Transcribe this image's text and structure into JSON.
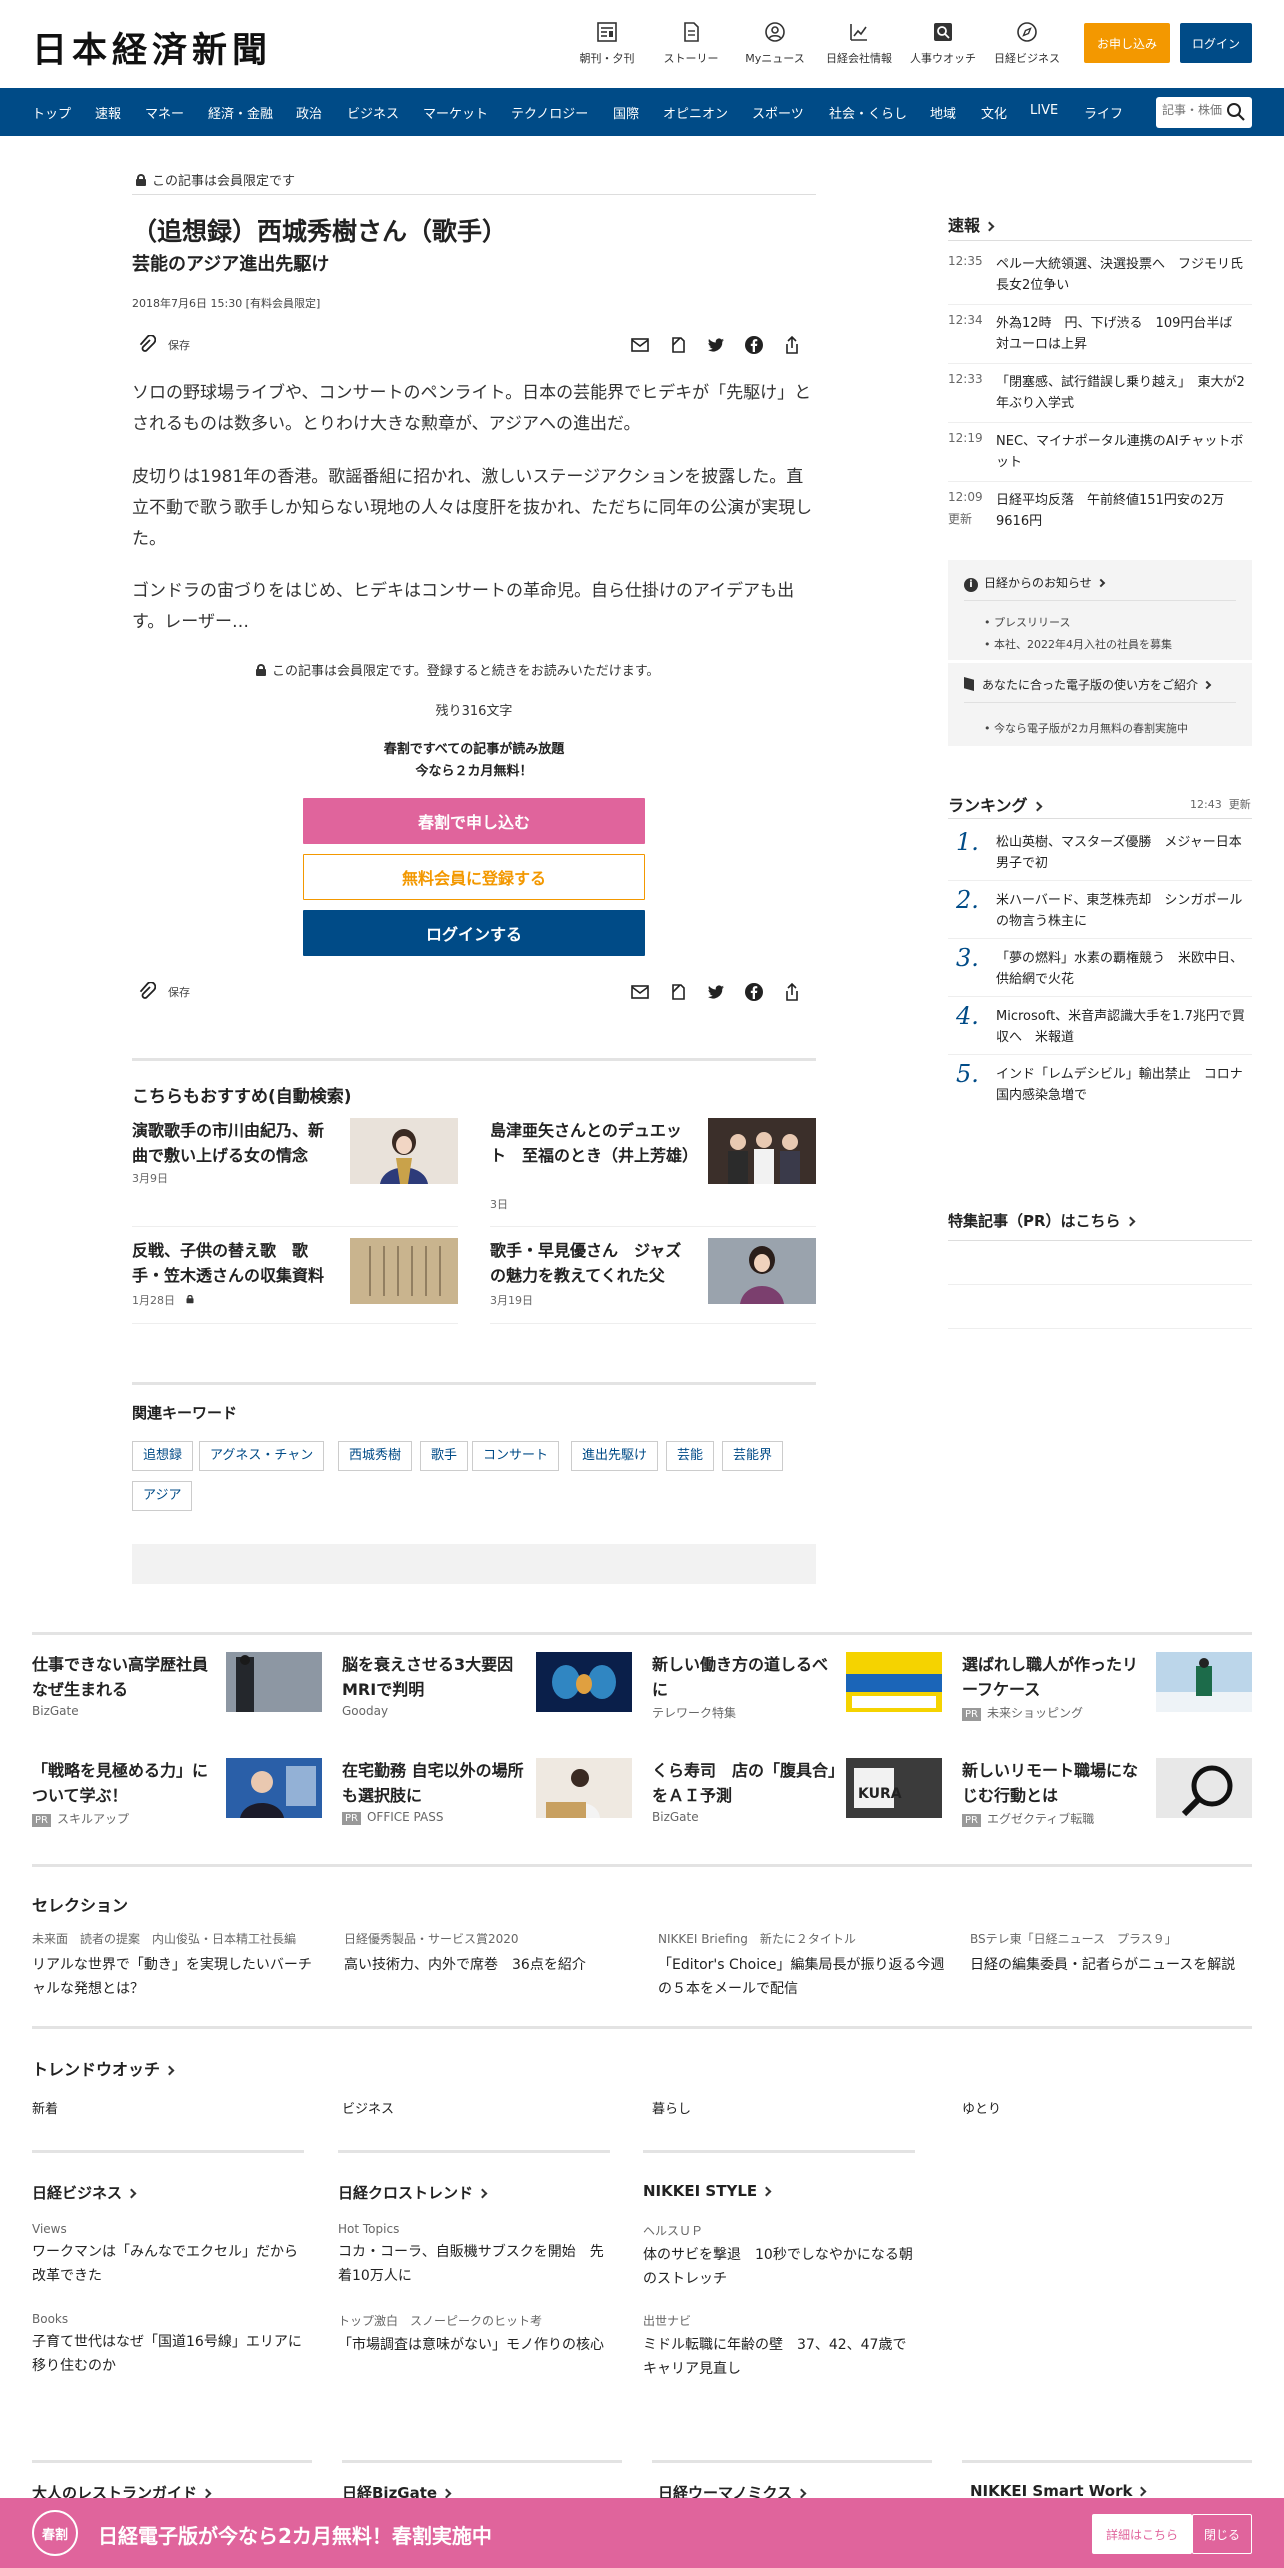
{
  "header": {
    "logo": "日本経済新聞",
    "icons": [
      {
        "label": "朝刊・夕刊",
        "icon": "newspaper-icon"
      },
      {
        "label": "ストーリー",
        "icon": "document-icon"
      },
      {
        "label": "Myニュース",
        "icon": "user-circle-icon"
      },
      {
        "label": "日経会社情報",
        "icon": "chart-icon"
      },
      {
        "label": "人事ウオッチ",
        "icon": "person-search-icon"
      },
      {
        "label": "日経ビジネス",
        "icon": "compass-icon"
      }
    ],
    "apply_label": "お申し込み",
    "login_label": "ログイン"
  },
  "nav": {
    "items": [
      "トップ",
      "速報",
      "マネー",
      "経済・金融",
      "政治",
      "ビジネス",
      "マーケット",
      "テクノロジー",
      "国際",
      "オピニオン",
      "スポーツ",
      "社会・くらし",
      "地域",
      "文化",
      "LIVE",
      "ライフ"
    ],
    "search_placeholder": "記事・株価"
  },
  "article": {
    "member_only_label": "この記事は会員限定です",
    "title": "（追想録）西城秀樹さん（歌手）",
    "subtitle": "芸能のアジア進出先駆け",
    "date": "2018年7月6日 15:30 [有料会員限定]",
    "save_label": "保存",
    "paragraphs": [
      "ソロの野球場ライブや、コンサートのペンライト。日本の芸能界でヒデキが「先駆け」とされるものは数多い。とりわけ大きな勲章が、アジアへの進出だ。",
      "皮切りは1981年の香港。歌謡番組に招かれ、激しいステージアクションを披露した。直立不動で歌う歌手しか知らない現地の人々は度肝を抜かれ、ただちに同年の公演が実現した。",
      "ゴンドラの宙づりをはじめ、ヒデキはコンサートの革命児。自ら仕掛けのアイデアも出す。レーザー…"
    ],
    "paywall_notice": "この記事は会員限定です。登録すると続きをお読みいただけます。",
    "remaining": "残り316文字",
    "promo_line1": "春割ですべての記事が読み放題",
    "promo_line2": "今なら２カ月無料！",
    "btn_spring": "春割で申し込む",
    "btn_free": "無料会員に登録する",
    "btn_login": "ログインする"
  },
  "recommend": {
    "heading": "こちらもおすすめ(自動検索)",
    "items": [
      {
        "title": "演歌歌手の市川由紀乃、新曲で敷い上げる女の情念",
        "date": "3月9日",
        "locked": false
      },
      {
        "title": "島津亜矢さんとのデュエット　至福のとき（井上芳雄）",
        "date": "3日",
        "locked": false
      },
      {
        "title": "反戦、子供の替え歌　歌手・笠木透さんの収集資料",
        "date": "1月28日",
        "locked": true
      },
      {
        "title": "歌手・早見優さん　ジャズの魅力を教えてくれた父",
        "date": "3月19日",
        "locked": false
      }
    ]
  },
  "keywords": {
    "heading": "関連キーワード",
    "items": [
      "追想録",
      "アグネス・チャン",
      "西城秀樹",
      "歌手",
      "コンサート",
      "進出先駆け",
      "芸能",
      "芸能界",
      "アジア"
    ]
  },
  "sidebar": {
    "breaking_title": "速報",
    "breaking": [
      {
        "time": "12:35",
        "text": "ペルー大統領選、決選投票へ　フジモリ氏長女2位争い"
      },
      {
        "time": "12:34",
        "text": "外為12時　円、下げ渋る　109円台半ば　対ユーロは上昇"
      },
      {
        "time": "12:33",
        "text": "「閉塞感、試行錯誤し乗り越え」　東大が2年ぶり入学式"
      },
      {
        "time": "12:19",
        "text": "NEC、マイナポータル連携のAIチャットボット"
      },
      {
        "time": "12:09",
        "text": "日経平均反落　午前終値151円安の2万9616円",
        "updated": "更新"
      }
    ],
    "notice_title": "日経からのお知らせ",
    "notice_items": [
      "プレスリリース",
      "本社、2022年4月入社の社員を募集"
    ],
    "guide_title": "あなたに合った電子版の使い方をご紹介",
    "guide_items": [
      "今なら電子版が2カ月無料の春割実施中"
    ],
    "ranking_title": "ランキング",
    "ranking_time": "12:43  更新",
    "ranking": [
      "松山英樹、マスターズ優勝　メジャー日本男子で初",
      "米ハーバード、東芝株売却　シンガポールの物言う株主に",
      "「夢の燃料」水素の覇権競う　米欧中日、供給網で火花",
      "Microsoft、米音声認識大手を1.7兆円で買収へ　米報道",
      "インド「レムデシビル」輸出禁止　コロナ国内感染急増で"
    ],
    "special_title": "特集記事（PR）はこちら"
  },
  "pr_ads": [
    {
      "title": "仕事できない高学歴社員なぜ生まれる",
      "source": "BizGate",
      "pr": false
    },
    {
      "title": "脳を衰えさせる3大要因　MRIで判明",
      "source": "Gooday",
      "pr": false
    },
    {
      "title": "新しい働き方の道しるべに",
      "source": "テレワーク特集",
      "pr": false
    },
    {
      "title": "選ばれし職人が作ったリーフケース",
      "source": "未来ショッピング",
      "pr": true
    },
    {
      "title": "「戦略を見極める力」について学ぶ！",
      "source": "スキルアップ",
      "pr": true
    },
    {
      "title": "在宅勤務 自宅以外の場所も選択肢に",
      "source": "OFFICE PASS",
      "pr": true
    },
    {
      "title": "くら寿司　店の「腹具合」をＡＩ予測",
      "source": "BizGate",
      "pr": false
    },
    {
      "title": "新しいリモート職場になじむ行動とは",
      "source": "エグゼクティブ転職",
      "pr": true
    }
  ],
  "selection": {
    "heading": "セレクション",
    "items": [
      {
        "kicker": "未来面　読者の提案　内山俊弘・日本精工社長編",
        "title": "リアルな世界で「動き」を実現したいバーチャルな発想とは？"
      },
      {
        "kicker": "日経優秀製品・サービス賞2020",
        "title": "高い技術力、内外で席巻　36点を紹介"
      },
      {
        "kicker": "NIKKEI Briefing　新たに２タイトル",
        "title": "「Editor's Choice」編集局長が振り返る今週の５本をメールで配信"
      },
      {
        "kicker": "BSテレ東「日経ニュース　プラス９」",
        "title": "日経の編集委員・記者らがニュースを解説"
      }
    ]
  },
  "trend": {
    "heading": "トレンドウオッチ",
    "tabs": [
      "新着",
      "ビジネス",
      "暮らし",
      "ゆとり"
    ]
  },
  "media": [
    {
      "title": "日経ビジネス",
      "items": [
        {
          "kicker": "Views",
          "title": "ワークマンは「みんなでエクセル」だから改革できた"
        },
        {
          "kicker": "Books",
          "title": "子育て世代はなぜ「国道16号線」エリアに移り住むのか"
        }
      ]
    },
    {
      "title": "日経クロストレンド",
      "items": [
        {
          "kicker": "Hot Topics",
          "title": "コカ・コーラ、自販機サブスクを開始　先着10万人に"
        },
        {
          "kicker": "トップ激白　スノーピークのヒット考",
          "title": "「市場調査は意味がない」モノ作りの核心"
        }
      ]
    },
    {
      "title": "NIKKEI STYLE",
      "items": [
        {
          "kicker": "ヘルスＵＰ",
          "title": "体のサビを撃退　10秒でしなやかになる朝のストレッチ"
        },
        {
          "kicker": "出世ナビ",
          "title": "ミドル転職に年齢の壁　37、42、47歳でキャリア見直し"
        }
      ]
    }
  ],
  "bottom_links": [
    "大人のレストランガイド",
    "日経BizGate",
    "日経ウーマノミクス",
    "NIKKEI Smart Work"
  ],
  "banner": {
    "badge": "春割",
    "text": "日経電子版が今なら2カ月無料！春割実施中",
    "details_label": "詳細はこちら",
    "close_label": "閉じる"
  },
  "colors": {
    "nav_blue": "#004b87",
    "orange": "#f39800",
    "pink": "#e0649c"
  }
}
